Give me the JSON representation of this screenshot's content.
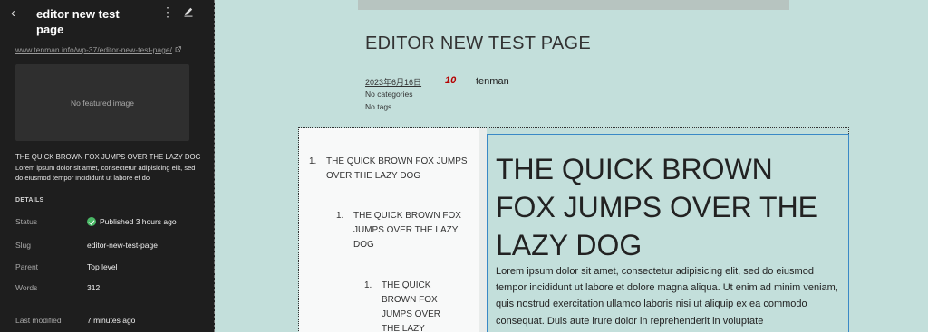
{
  "sidebar": {
    "back_icon": "chevron-left-icon",
    "title": "editor new test page",
    "more_icon": "more-vertical-icon",
    "edit_icon": "pencil-icon",
    "url": "www.tenman.info/wp-37/editor-new-test-page/",
    "featured_image": "No featured image",
    "excerpt_title": "THE QUICK BROWN FOX JUMPS OVER THE LAZY DOG",
    "excerpt": "Lorem ipsum dolor sit amet, consectetur adipisicing elit, sed do eiusmod tempor incididunt ut labore et do",
    "details_heading": "DETAILS",
    "rows": [
      {
        "label": "Status",
        "value": "Published 3 hours ago"
      },
      {
        "label": "Slug",
        "value": "editor-new-test-page"
      },
      {
        "label": "Parent",
        "value": "Top level"
      },
      {
        "label": "Words",
        "value": "312"
      },
      {
        "label": "Last modified",
        "value": "7 minutes ago"
      }
    ],
    "status_color": "#4ab866"
  },
  "canvas": {
    "post_title": "EDITOR NEW TEST PAGE",
    "date": "2023年6月16日",
    "date_badge": "10",
    "author": "tenman",
    "categories": "No categories",
    "tags": "No tags",
    "list": [
      {
        "num": "1.",
        "text": "THE QUICK BROWN FOX JUMPS OVER THE LAZY DOG"
      },
      {
        "num": "1.",
        "text": "THE QUICK BROWN FOX JUMPS OVER THE LAZY DOG"
      },
      {
        "num": "1.",
        "text": "THE QUICK BROWN FOX JUMPS OVER THE LAZY"
      }
    ],
    "heading": "THE QUICK BROWN FOX JUMPS OVER THE LAZY DOG",
    "paragraph": "Lorem ipsum dolor sit amet, consectetur adipisicing elit, sed do eiusmod tempor incididunt ut labore et dolore magna aliqua. Ut enim ad minim veniam, quis nostrud exercitation ullamco laboris nisi ut aliquip ex ea commodo consequat. Duis aute irure dolor in reprehenderit in voluptate",
    "background_color": "#c3dfdb",
    "accent_color": "#3a89c6"
  }
}
